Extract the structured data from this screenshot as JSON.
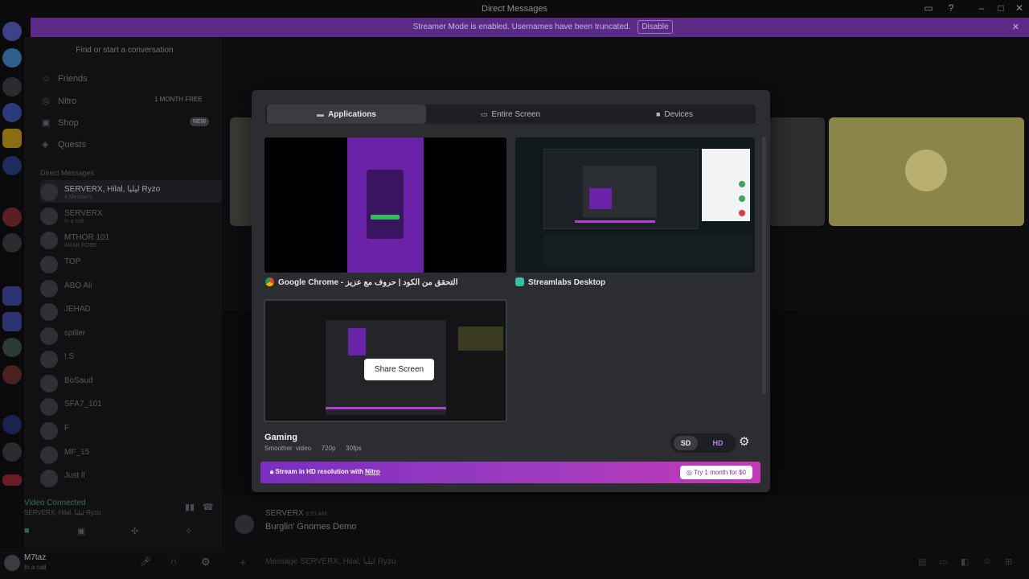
{
  "window": {
    "title": "Direct Messages"
  },
  "banner": {
    "text": "Streamer Mode is enabled. Usernames have been truncated.",
    "disable": "Disable"
  },
  "dm": {
    "find": "Find or start a conversation",
    "nav": [
      {
        "label": "Friends",
        "icon": "friends-icon"
      },
      {
        "label": "Nitro",
        "icon": "nitro-icon"
      },
      {
        "label": "Shop",
        "icon": "shop-icon"
      },
      {
        "label": "Quests",
        "icon": "quests-icon"
      }
    ],
    "nitro_badge": "1 MONTH FREE",
    "shop_badge": "NEW",
    "header": "Direct Messages",
    "rows": [
      {
        "name": "SERVERX, Hilal, ليليا Ryzo",
        "sub": "4 Members"
      },
      {
        "name": "SERVERX",
        "sub": "In a call"
      },
      {
        "name": "MTHOR 101",
        "sub": "ARAB POBE"
      },
      {
        "name": "TOP",
        "sub": ""
      },
      {
        "name": "ABO Ali",
        "sub": ""
      },
      {
        "name": "JEHAD",
        "sub": ""
      },
      {
        "name": "spiller",
        "sub": ""
      },
      {
        "name": "!.S",
        "sub": ""
      },
      {
        "name": "BoSaud",
        "sub": ""
      },
      {
        "name": "SFA7_101",
        "sub": ""
      },
      {
        "name": "F",
        "sub": ""
      },
      {
        "name": "MF_15",
        "sub": ""
      },
      {
        "name": "Just ll",
        "sub": ""
      }
    ],
    "voice": {
      "label": "Video Connected",
      "sub": "SERVERX, Hilal, ليليا Ryzo"
    },
    "user": {
      "name": "M7taz",
      "status": "In a call"
    }
  },
  "chat": {
    "author": "SERVERX",
    "time": "6:51 AM",
    "message": "Burglin' Gnomes Demo",
    "placeholder": "Message SERVERX, Hilal, ليليا Ryzo"
  },
  "modal": {
    "tabs": [
      "Applications",
      "Entire Screen",
      "Devices"
    ],
    "sources": [
      {
        "caption": "Google Chrome - التحقق من الكود | حروف مع عزيز",
        "icon": "chrome-icon"
      },
      {
        "caption": "Streamlabs Desktop",
        "icon": "streamlabs-icon"
      },
      {
        "caption": "",
        "hover": "Share Screen"
      }
    ],
    "quality": {
      "title": "Gaming",
      "desc": "Smoother video",
      "resolution": "720p",
      "fps": "30fps",
      "sd": "SD",
      "hd": "HD"
    },
    "nitro": {
      "text": "Stream in HD resolution with",
      "link": "Nitro",
      "cta": "Try 1 month for $0"
    }
  },
  "colors": {
    "accent": "#5865f2",
    "nitro_start": "#7b2ec0",
    "nitro_end": "#c53ab5",
    "banner": "#5b2a86"
  }
}
